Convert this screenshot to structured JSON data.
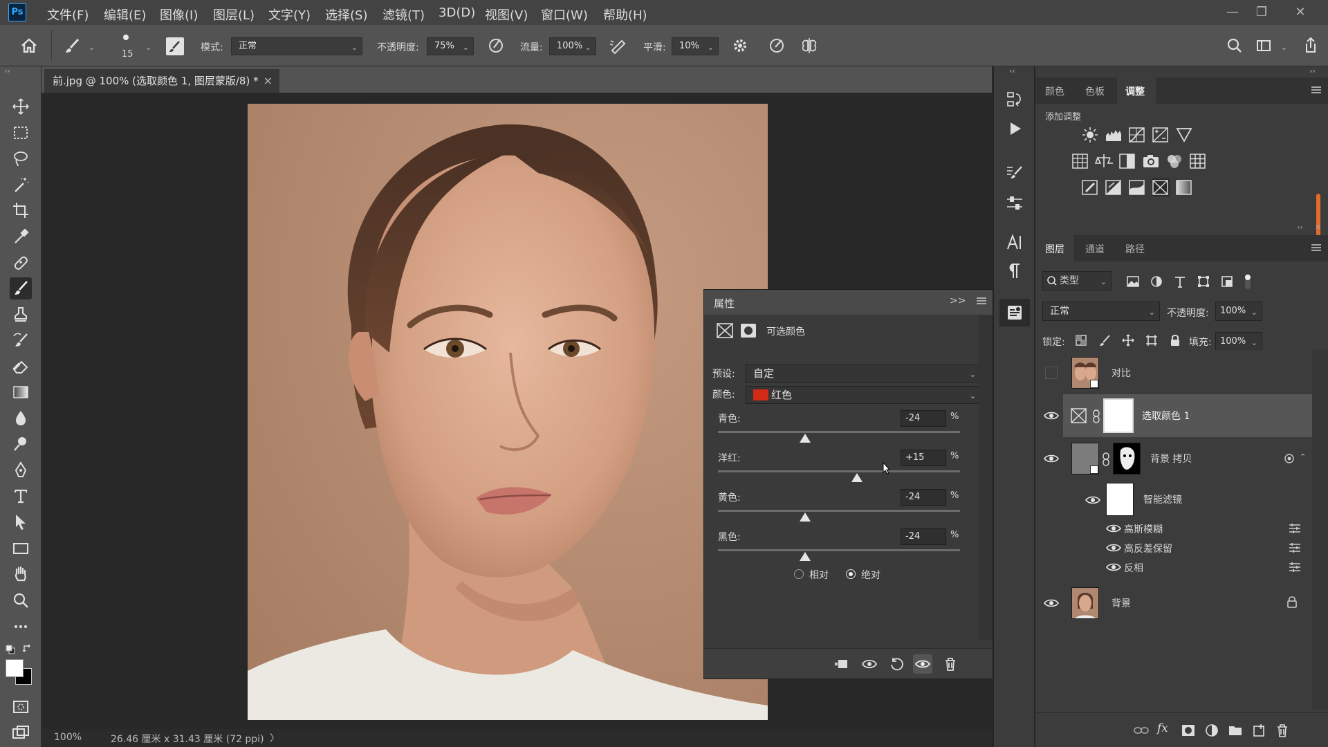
{
  "app": {
    "logo": "Ps"
  },
  "menu": [
    "文件(F)",
    "编辑(E)",
    "图像(I)",
    "图层(L)",
    "文字(Y)",
    "选择(S)",
    "滤镜(T)",
    "3D(D)",
    "视图(V)",
    "窗口(W)",
    "帮助(H)"
  ],
  "window_controls": {
    "minimize": "—",
    "restore": "❐",
    "close": "✕"
  },
  "options": {
    "brush_size": "15",
    "mode_label": "模式:",
    "mode_value": "正常",
    "opacity_label": "不透明度:",
    "opacity_value": "75%",
    "flow_label": "流量:",
    "flow_value": "100%",
    "smooth_label": "平滑:",
    "smooth_value": "10%"
  },
  "document": {
    "tab_title": "前.jpg @ 100% (选取颜色 1, 图层蒙版/8) *",
    "tab_close": "×",
    "zoom": "100%",
    "dimensions": "26.46 厘米 x 31.43 厘米 (72 ppi)",
    "status_arrow": "〉"
  },
  "properties": {
    "title": "属性",
    "collapse": ">>",
    "adjustment_name": "可选颜色",
    "preset_label": "预设:",
    "preset_value": "自定",
    "color_label": "颜色:",
    "color_value": "红色",
    "color_swatch": "#d42a18",
    "sliders": [
      {
        "label": "青色:",
        "value": "-24",
        "unit": "%",
        "level": 0.36
      },
      {
        "label": "洋红:",
        "value": "+15",
        "unit": "%",
        "level": 0.575
      },
      {
        "label": "黄色:",
        "value": "-24",
        "unit": "%",
        "level": 0.36
      },
      {
        "label": "黑色:",
        "value": "-24",
        "unit": "%",
        "level": 0.36
      }
    ],
    "method_relative": "相对",
    "method_absolute": "绝对",
    "method_selected": "绝对"
  },
  "right": {
    "top_tabs": [
      "颜色",
      "色板",
      "调整"
    ],
    "top_active": "调整",
    "add_adjustment": "添加调整",
    "layer_tabs": [
      "图层",
      "通道",
      "路径"
    ],
    "layer_active": "图层",
    "filter_kind": "类型",
    "blend_mode": "正常",
    "opacity_label": "不透明度:",
    "opacity_value": "100%",
    "lock_label": "锁定:",
    "fill_label": "填充:",
    "fill_value": "100%",
    "layers": {
      "contrast": "对比",
      "selective_color": "选取颜色 1",
      "bg_copy": "背景 拷贝",
      "smart_filters": "智能滤镜",
      "gaussian": "高斯模糊",
      "high_pass": "高反差保留",
      "invert": "反相",
      "background": "背景"
    }
  },
  "colors": {
    "accent": "#31a8ff",
    "skin_bg": "#b48a6e"
  }
}
